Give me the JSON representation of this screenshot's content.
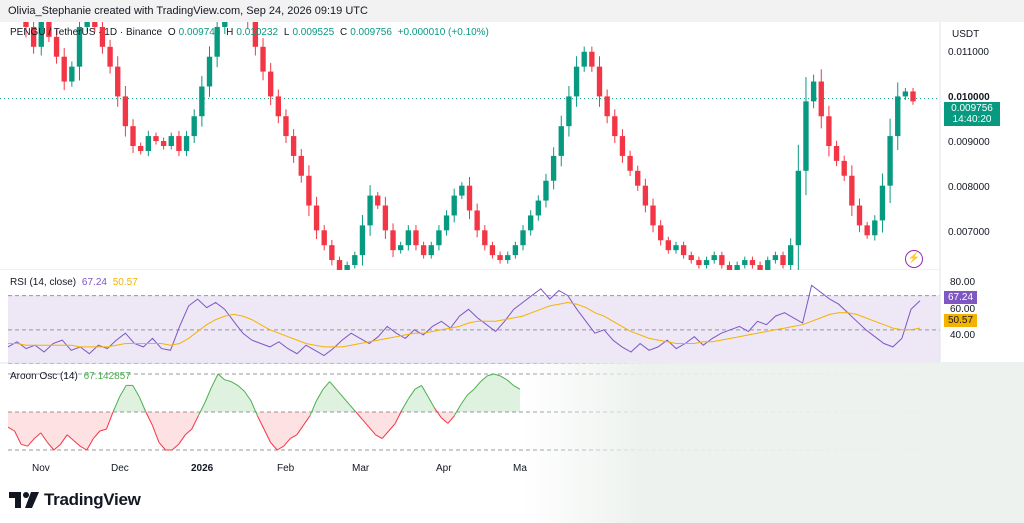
{
  "header": {
    "author_line": "Olivia_Stephanie created with TradingView.com, Sep 24, 2026 09:19 UTC"
  },
  "legend": {
    "symbol": "PENGU / TetherUS · 1D · Binance",
    "open_label": "O",
    "open": "0.009746",
    "high_label": "H",
    "high": "0.010232",
    "low_label": "L",
    "low": "0.009525",
    "close_label": "C",
    "close": "0.009756",
    "change": "+0.000010 (+0.10%)"
  },
  "price_axis": {
    "currency": "USDT",
    "ticks": [
      "0.011000",
      "0.010000",
      "0.009000",
      "0.008000",
      "0.007000"
    ],
    "last_price": "0.009756",
    "countdown": "14:40:20"
  },
  "rsi": {
    "label": "RSI (14, close)",
    "rsi_value": "67.24",
    "ma_value": "50.57",
    "ticks": [
      "80.00",
      "60.00",
      "40.00"
    ],
    "rsi_color": "#7e57c2",
    "ma_color": "#f5b301"
  },
  "aroon": {
    "label": "Aroon Osc (14)",
    "value": "67.142857",
    "up_color": "#4caf50",
    "down_color": "#f23645"
  },
  "x_axis": {
    "labels": [
      "Nov",
      "Dec",
      "2026",
      "Feb",
      "Mar",
      "Apr",
      "Ma"
    ]
  },
  "footer": {
    "brand": "TradingView"
  },
  "colors": {
    "up": "#089981",
    "down": "#f23645",
    "rsi_band": "#ede7f6"
  },
  "chart_data": [
    {
      "type": "candlestick",
      "title": "PENGU / TetherUS · 1D · Binance",
      "ylabel": "USDT",
      "ylim": [
        0.0063,
        0.0113
      ],
      "x_labels": [
        "Nov",
        "Dec",
        "2026",
        "Feb",
        "Mar",
        "Apr",
        "Ma"
      ],
      "last_close": 0.009756,
      "close_series": [
        0.0124,
        0.0118,
        0.0112,
        0.0108,
        0.0113,
        0.011,
        0.0106,
        0.0101,
        0.0104,
        0.0112,
        0.0115,
        0.0112,
        0.0108,
        0.0104,
        0.0098,
        0.0092,
        0.0088,
        0.0087,
        0.009,
        0.0089,
        0.0088,
        0.009,
        0.0087,
        0.009,
        0.0094,
        0.01,
        0.0106,
        0.0112,
        0.0116,
        0.0118,
        0.0117,
        0.0113,
        0.0108,
        0.0103,
        0.0098,
        0.0094,
        0.009,
        0.0086,
        0.0082,
        0.0076,
        0.0071,
        0.0068,
        0.0065,
        0.0063,
        0.0064,
        0.0066,
        0.0072,
        0.0078,
        0.0076,
        0.0071,
        0.0067,
        0.0068,
        0.0071,
        0.0068,
        0.0066,
        0.0068,
        0.0071,
        0.0074,
        0.0078,
        0.008,
        0.0075,
        0.0071,
        0.0068,
        0.0066,
        0.0065,
        0.0066,
        0.0068,
        0.0071,
        0.0074,
        0.0077,
        0.0081,
        0.0086,
        0.0092,
        0.0098,
        0.0104,
        0.0107,
        0.0104,
        0.0098,
        0.0094,
        0.009,
        0.0086,
        0.0083,
        0.008,
        0.0076,
        0.0072,
        0.0069,
        0.0067,
        0.0068,
        0.0066,
        0.0065,
        0.0064,
        0.0065,
        0.0066,
        0.0064,
        0.0063,
        0.0064,
        0.0065,
        0.0064,
        0.0063,
        0.0065,
        0.0066,
        0.0064,
        0.0068,
        0.0083,
        0.0097,
        0.0101,
        0.0094,
        0.0088,
        0.0085,
        0.0082,
        0.0076,
        0.0072,
        0.007,
        0.0073,
        0.008,
        0.009,
        0.0098,
        0.0099,
        0.0097
      ]
    },
    {
      "type": "line",
      "title": "RSI (14, close)",
      "ylim": [
        30,
        85
      ],
      "series": [
        {
          "name": "RSI",
          "values": [
            40,
            43,
            39,
            41,
            37,
            42,
            44,
            38,
            40,
            36,
            41,
            39,
            44,
            48,
            42,
            40,
            45,
            39,
            38,
            52,
            64,
            68,
            63,
            66,
            62,
            55,
            48,
            44,
            42,
            40,
            43,
            39,
            36,
            41,
            38,
            35,
            39,
            44,
            48,
            45,
            42,
            46,
            52,
            48,
            45,
            50,
            47,
            52,
            55,
            51,
            58,
            62,
            57,
            53,
            49,
            55,
            62,
            66,
            70,
            74,
            68,
            73,
            70,
            62,
            55,
            48,
            50,
            44,
            40,
            37,
            42,
            38,
            40,
            44,
            39,
            42,
            46,
            41,
            45,
            48,
            50,
            52,
            49,
            55,
            53,
            58,
            60,
            57,
            54,
            76,
            72,
            68,
            65,
            60,
            55,
            50,
            46,
            42,
            40,
            45,
            62,
            67
          ]
        },
        {
          "name": "MA",
          "values": [
            42,
            42,
            41,
            41,
            41,
            41,
            41,
            41,
            40,
            40,
            40,
            40,
            41,
            42,
            42,
            42,
            42,
            42,
            41,
            42,
            45,
            49,
            53,
            56,
            58,
            59,
            58,
            56,
            53,
            50,
            48,
            46,
            44,
            42,
            41,
            40,
            40,
            40,
            41,
            42,
            43,
            44,
            45,
            46,
            47,
            48,
            48,
            49,
            50,
            51,
            52,
            54,
            55,
            55,
            55,
            56,
            57,
            58,
            60,
            62,
            64,
            65,
            66,
            65,
            63,
            60,
            58,
            55,
            52,
            49,
            47,
            45,
            44,
            43,
            42,
            42,
            42,
            43,
            43,
            44,
            45,
            46,
            47,
            48,
            49,
            50,
            51,
            52,
            53,
            55,
            57,
            59,
            60,
            60,
            59,
            57,
            55,
            53,
            51,
            50,
            50,
            51
          ]
        }
      ]
    },
    {
      "type": "area",
      "title": "Aroon Osc (14)",
      "ylim": [
        -100,
        100
      ],
      "values": [
        -40,
        -50,
        -85,
        -90,
        -70,
        -55,
        -80,
        -100,
        -85,
        -60,
        -75,
        -90,
        -100,
        -70,
        -50,
        -45,
        0,
        40,
        70,
        70,
        40,
        0,
        -35,
        -80,
        -100,
        -100,
        -85,
        -60,
        -45,
        -10,
        25,
        65,
        100,
        85,
        80,
        70,
        55,
        30,
        -10,
        -45,
        -80,
        -100,
        -90,
        -70,
        -60,
        -35,
        -10,
        30,
        60,
        80,
        60,
        40,
        20,
        0,
        -20,
        -40,
        -60,
        -70,
        -50,
        -30,
        5,
        35,
        60,
        70,
        40,
        10,
        -15,
        -30,
        -10,
        20,
        45,
        60,
        80,
        95,
        100,
        95,
        85,
        70,
        60
      ]
    }
  ]
}
